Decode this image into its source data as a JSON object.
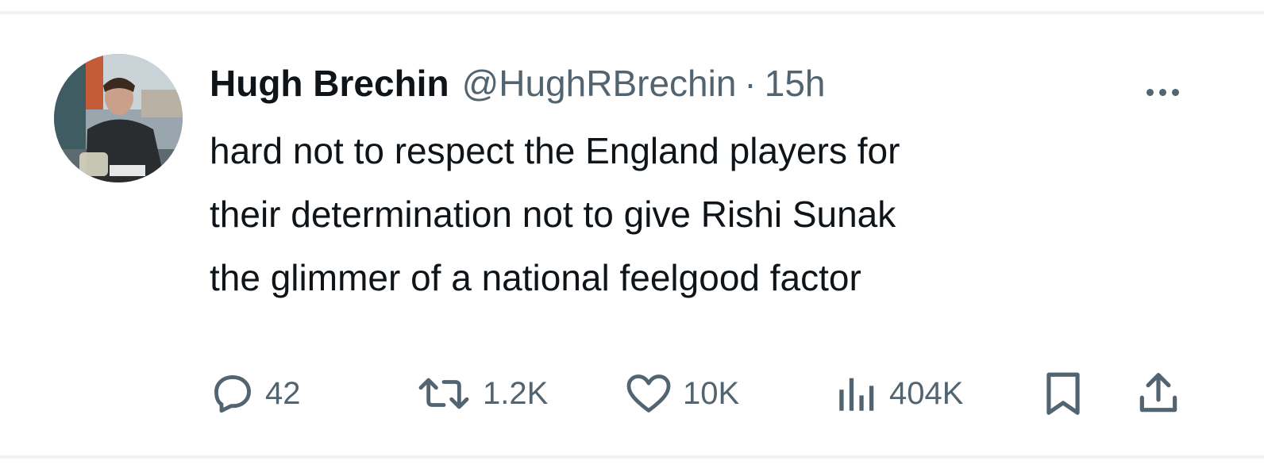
{
  "tweet": {
    "author": {
      "display_name": "Hugh Brechin",
      "handle": "@HughRBrechin"
    },
    "separator": "·",
    "time": "15h",
    "text_lines": [
      "hard not to respect the England players for",
      "their determination not to give Rishi Sunak",
      "the glimmer of a national feelgood factor"
    ],
    "stats": {
      "replies": "42",
      "reposts": "1.2K",
      "likes": "10K",
      "views": "404K"
    }
  },
  "icons": {
    "reply": "reply-icon",
    "repost": "repost-icon",
    "like": "heart-icon",
    "views": "views-chart-icon",
    "bookmark": "bookmark-icon",
    "share": "share-icon",
    "more": "more-icon"
  },
  "colors": {
    "text": "#0f1419",
    "secondary": "#536471",
    "divider": "#eff3f4"
  }
}
